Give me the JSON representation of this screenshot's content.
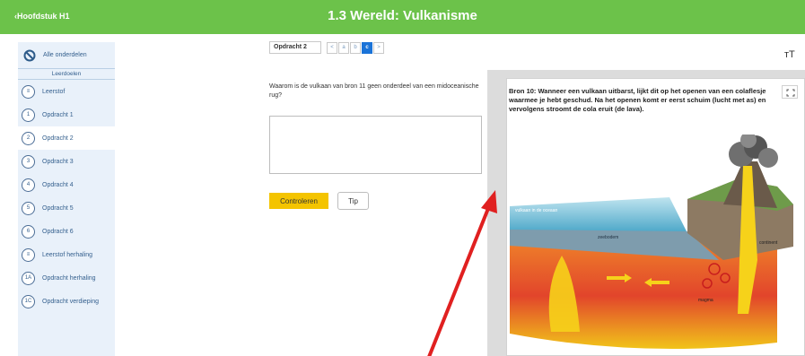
{
  "header": {
    "back_label": "Hoofdstuk H1",
    "title": "1.3 Wereld: Vulkanisme"
  },
  "sidebar": {
    "all_label": "Alle onderdelen",
    "section_label": "Leerdoelen",
    "items": [
      {
        "badge": "≡",
        "label": "Leerstof",
        "active": false
      },
      {
        "badge": "1",
        "label": "Opdracht 1",
        "active": false
      },
      {
        "badge": "2",
        "label": "Opdracht 2",
        "active": true
      },
      {
        "badge": "3",
        "label": "Opdracht 3",
        "active": false
      },
      {
        "badge": "4",
        "label": "Opdracht 4",
        "active": false
      },
      {
        "badge": "5",
        "label": "Opdracht 5",
        "active": false
      },
      {
        "badge": "6",
        "label": "Opdracht 6",
        "active": false
      },
      {
        "badge": "≡",
        "label": "Leerstof herhaling",
        "active": false
      },
      {
        "badge": "1A",
        "label": "Opdracht herhaling",
        "active": false
      },
      {
        "badge": "1C",
        "label": "Opdracht verdieping",
        "active": false
      }
    ]
  },
  "pager": {
    "current": "Opdracht 2",
    "prev": "<",
    "parts": [
      "a",
      "b",
      "c"
    ],
    "active_part": "c",
    "next": ">"
  },
  "text_size_label": "тT",
  "question": {
    "text": "Waarom is de vulkaan van bron 11 geen onderdeel van een midoceanische rug?",
    "answer_value": ""
  },
  "buttons": {
    "check": "Controleren",
    "tip": "Tip"
  },
  "source": {
    "text": "Bron 10: Wanneer een vulkaan uitbarst, lijkt dit op het openen van een colaflesje waarmee je hebt geschud. Na het openen komt er eerst schuim (lucht met as) en vervolgens stroomt de cola eruit (de lava).",
    "labels": {
      "oceanic": "vulkaan in de oceaan",
      "oceanic_crust": "zeebodem",
      "continent": "continent",
      "magma": "magma"
    }
  },
  "colors": {
    "header": "#6cc24a",
    "sidebar": "#e9f1fa",
    "accent": "#1a73d8",
    "check_button": "#f4c400",
    "arrow": "#e02020"
  }
}
